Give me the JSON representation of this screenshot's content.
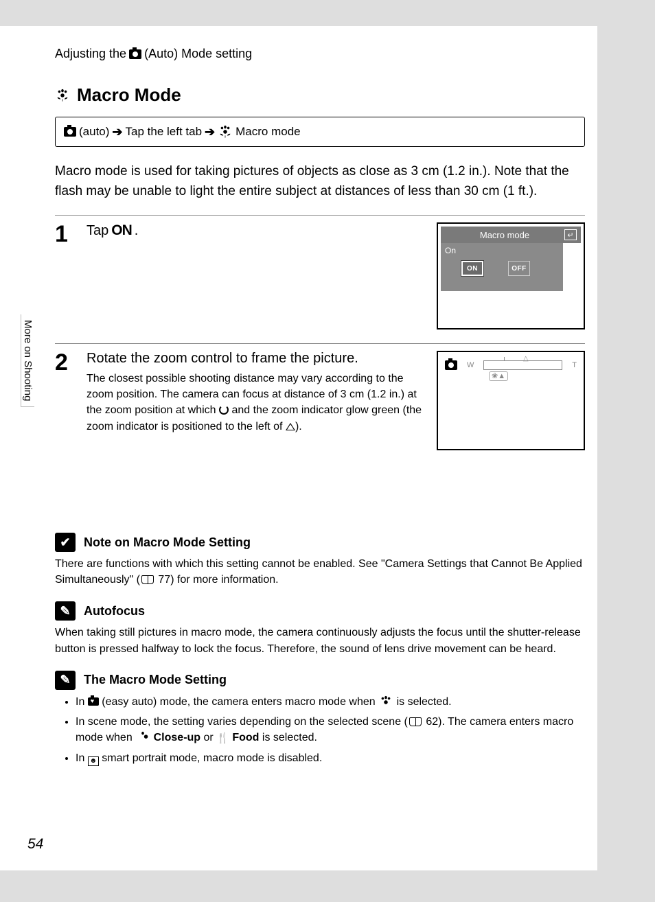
{
  "header": {
    "prefix": "Adjusting the",
    "suffix": "(Auto) Mode setting"
  },
  "title": "Macro Mode",
  "breadcrumb": {
    "part1": "(auto)",
    "part2": "Tap the left tab",
    "part3": "Macro mode"
  },
  "intro": "Macro mode is used for taking pictures of objects as close as 3 cm (1.2 in.). Note that the flash may be unable to light the entire subject at distances of less than 30 cm (1 ft.).",
  "side_tab": "More on Shooting",
  "steps": [
    {
      "num": "1",
      "headline_prefix": "Tap",
      "headline_glyph": "ON",
      "headline_suffix": ".",
      "lcd": {
        "title": "Macro mode",
        "status": "On",
        "on_label": "ON",
        "off_label": "OFF"
      }
    },
    {
      "num": "2",
      "headline": "Rotate the zoom control to frame the picture.",
      "desc_part1": "The closest possible shooting distance may vary according to the zoom position. The camera can focus at distance of 3 cm (1.2 in.) at the zoom position at which",
      "desc_part2": "and the zoom indicator glow green (the zoom indicator is positioned to the left of",
      "desc_part3": ")."
    }
  ],
  "notes": [
    {
      "icon": "✔",
      "title": "Note on Macro Mode Setting",
      "body_a": "There are functions with which this setting cannot be enabled. See \"Camera Settings that Cannot Be Applied Simultaneously\" (",
      "body_ref": "77",
      "body_b": ") for more information."
    },
    {
      "icon": "✎",
      "title": "Autofocus",
      "body": "When taking still pictures in macro mode, the camera continuously adjusts the focus until the shutter-release button is pressed halfway to lock the focus. Therefore, the sound of lens drive movement can be heard."
    },
    {
      "icon": "✎",
      "title": "The Macro Mode Setting",
      "bullets": {
        "b1_a": "In",
        "b1_b": "(easy auto) mode, the camera enters macro mode when",
        "b1_c": "is selected.",
        "b2_a": "In scene mode, the setting varies depending on the selected scene (",
        "b2_ref": "62",
        "b2_b": "). The camera enters macro mode when",
        "b2_close": "Close-up",
        "b2_or": "or",
        "b2_food": "Food",
        "b2_c": "is selected.",
        "b3_a": "In",
        "b3_b": "smart portrait mode, macro mode is disabled."
      }
    }
  ],
  "page_number": "54"
}
